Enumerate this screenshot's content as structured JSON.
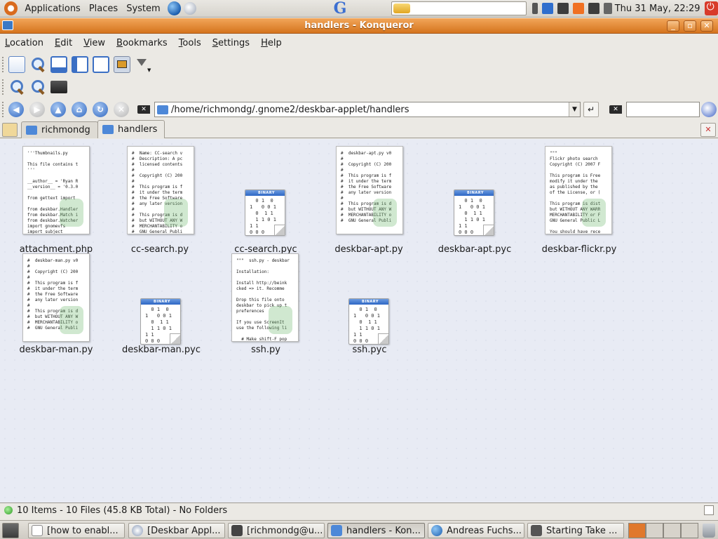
{
  "top_panel": {
    "menus": [
      "Applications",
      "Places",
      "System"
    ],
    "clock": "Thu 31 May, 22:29"
  },
  "window": {
    "title": "handlers - Konqueror"
  },
  "menubar": [
    "Location",
    "Edit",
    "View",
    "Bookmarks",
    "Tools",
    "Settings",
    "Help"
  ],
  "location": {
    "value": "/home/richmondg/.gnome2/deskbar-applet/handlers",
    "search_value": ""
  },
  "tabs": [
    {
      "label": "richmondg",
      "active": false
    },
    {
      "label": "handlers",
      "active": true
    }
  ],
  "files": [
    {
      "name": "attachment.php",
      "kind": "text"
    },
    {
      "name": "cc-search.py",
      "kind": "text"
    },
    {
      "name": "cc-search.pyc",
      "kind": "binary"
    },
    {
      "name": "deskbar-apt.py",
      "kind": "text"
    },
    {
      "name": "deskbar-apt.pyc",
      "kind": "binary"
    },
    {
      "name": "deskbar-flickr.py",
      "kind": "text"
    },
    {
      "name": "deskbar-man.py",
      "kind": "text"
    },
    {
      "name": "deskbar-man.pyc",
      "kind": "binary"
    },
    {
      "name": "ssh.py",
      "kind": "text"
    },
    {
      "name": "ssh.pyc",
      "kind": "binary"
    }
  ],
  "previews": {
    "attachment.php": "'''Thumbnails.py\n\nThis file contains t\n'''\n\n__author__ = 'Ryan R\n__version__ = '0.3.0\n\nfrom gettext import\n\nfrom deskbar.Handler\nfrom deskbar.Match i\nfrom deskbar.Watcher\nimport gnomevfs\nimport subject",
    "cc-search.py": "#  Name: CC-search v\n#  Description: A pc\n#  licensed contents\n#\n#  Copyright (C) 200\n#\n#  This program is f\n#  it under the term\n#  the Free Software\n#  any later version\n#\n#  This program is d\n#  but WITHOUT ANY W\n#  MERCHANTABILITY o\n#  GNU General Publi",
    "deskbar-apt.py": "#  deskbar-apt.py v0\n#\n#  Copyright (C) 200\n#\n#  This program is f\n#  it under the term\n#  the Free Software\n#  any later version\n#\n#  This program is d\n#  but WITHOUT ANY W\n#  MERCHANTABILITY o\n#  GNU General Publi",
    "deskbar-flickr.py": "\"\"\"\nFlickr photo search\nCopyright (C) 2007 F\n\nThis program is Free\nmodify it under the\nas published by the\nof the License, or (\n\nThis program is dist\nbut WITHOUT ANY WARR\nMERCHANTABILITY or F\nGNU General Public L\n\nYou should have rece",
    "deskbar-man.py": "#  deskbar-man.py v0\n#\n#  Copyright (C) 200\n#\n#  This program is f\n#  it under the term\n#  the Free Software\n#  any later version\n#\n#  This program is d\n#  but WITHOUT ANY W\n#  MERCHANTABILITY o\n#  GNU General Publi",
    "ssh.py": "\"\"\"  ssh.py - deskbar\n\nInstallation:\n\nInstall http://beink\ncked => it. Recomme\n\nDrop this file onto\ndeskbar to pick up t\npreferences\n\nIf you use ScreenIt\nuse the following li\n\n  # Make shift-F pop",
    "binary": "BINARY\n 0 1  0\n1   0 0 1\n  0  1 1\n  1 1 0 1\n1 1\n0 0 0"
  },
  "status": {
    "text": "10 Items - 10 Files (45.8 KB Total) - No Folders"
  },
  "taskbar": [
    {
      "label": "[how to enabl...",
      "icon": "document-icon",
      "active": false
    },
    {
      "label": "[Deskbar Appl...",
      "icon": "browser-icon",
      "active": false
    },
    {
      "label": "[richmondg@u...",
      "icon": "terminal-icon",
      "active": false
    },
    {
      "label": "handlers - Kon...",
      "icon": "folder-icon",
      "active": true
    },
    {
      "label": "Andreas Fuchs...",
      "icon": "globe-icon",
      "active": false
    },
    {
      "label": "Starting Take ...",
      "icon": "camera-icon",
      "active": false
    }
  ],
  "colors": {
    "titlebar_accent": "#e08a37",
    "file_view_bg": "#e8ebf4",
    "selection_blue": "#4d88d8"
  }
}
